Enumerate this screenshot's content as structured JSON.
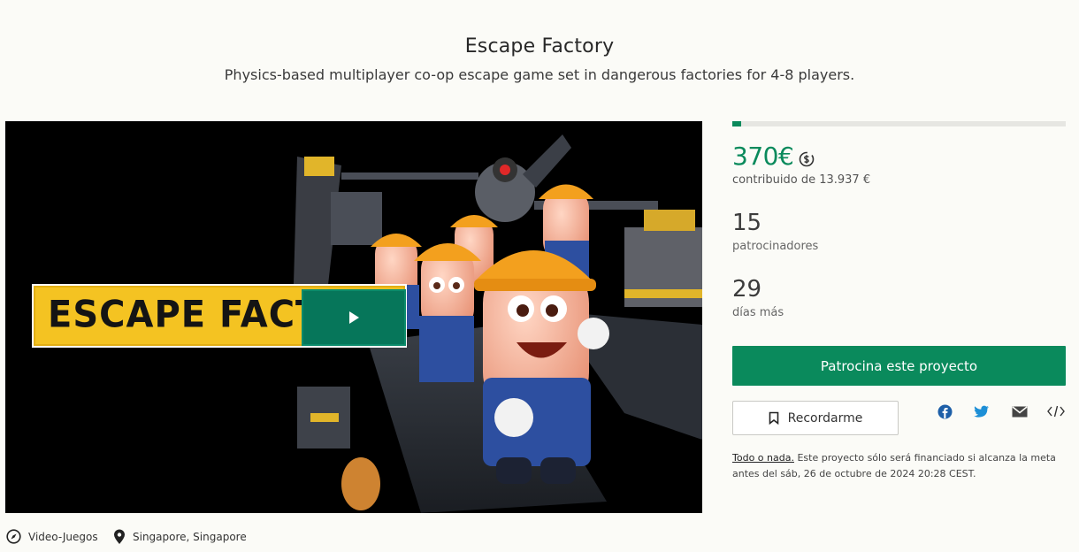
{
  "project": {
    "title": "Escape Factory",
    "subtitle": "Physics-based multiplayer co-op escape game set in dangerous factories for 4-8 players."
  },
  "video": {
    "banner_text": "ESCAPE FACT",
    "play_icon": "play-icon"
  },
  "funding": {
    "progress_fraction": 0.027,
    "raised": "370€",
    "raised_label": "contribuido de 13.937 €",
    "currency_icon": "currency-convert-icon",
    "backers": "15",
    "backers_label": "patrocinadores",
    "days": "29",
    "days_label": "días más"
  },
  "actions": {
    "back_label": "Patrocina este proyecto",
    "remind_label": "Recordarme",
    "share": [
      "facebook-icon",
      "twitter-icon",
      "email-icon",
      "embed-icon"
    ]
  },
  "note": {
    "link": "Todo o nada.",
    "text": " Este proyecto sólo será financiado si alcanza la meta antes del sáb, 26 de octubre de 2024 20:28 CEST."
  },
  "meta": {
    "category": "Video-Juegos",
    "location": "Singapore, Singapore"
  },
  "colors": {
    "accent": "#0a8a5c",
    "banner": "#f4c322",
    "play": "#06765a"
  }
}
